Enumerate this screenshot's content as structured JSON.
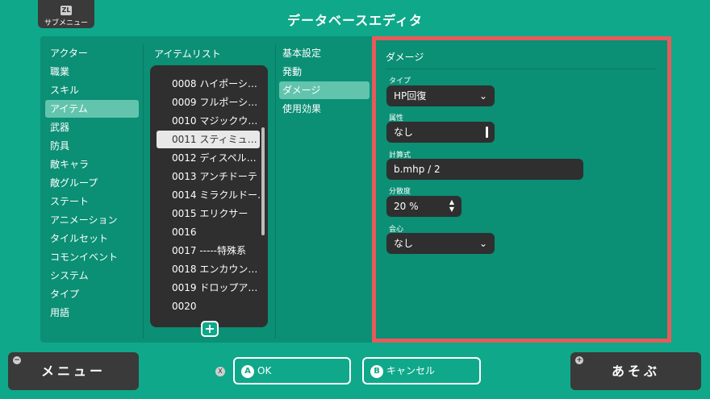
{
  "header": {
    "submenu_button_label": "ZL",
    "submenu_label": "サブメニュー",
    "title": "データベースエディタ"
  },
  "categories": {
    "items": [
      "アクター",
      "職業",
      "スキル",
      "アイテム",
      "武器",
      "防具",
      "敵キャラ",
      "敵グループ",
      "ステート",
      "アニメーション",
      "タイルセット",
      "コモンイベント",
      "システム",
      "タイプ",
      "用語"
    ],
    "selected": "アイテム"
  },
  "item_list": {
    "heading": "アイテムリスト",
    "items": [
      "0008 ハイポーシ…",
      "0009 フルポーシ…",
      "0010 マジックウ…",
      "0011 スティミュ…",
      "0012 ディスペル…",
      "0013 アンチドーテ",
      "0014 ミラクルドー…",
      "0015 エリクサー",
      "0016",
      "0017 -----特殊系",
      "0018 エンカウン…",
      "0019 ドロップア…",
      "0020"
    ],
    "selected": "0011 スティミュ…",
    "add_label": "+"
  },
  "tabs": {
    "items": [
      "基本設定",
      "発動",
      "ダメージ",
      "使用効果"
    ],
    "selected": "ダメージ"
  },
  "damage": {
    "heading": "ダメージ",
    "type_label": "タイプ",
    "type_value": "HP回復",
    "element_label": "属性",
    "element_value": "なし",
    "formula_label": "計算式",
    "formula_value": "b.mhp / 2",
    "variance_label": "分散度",
    "variance_value": "20 %",
    "critical_label": "会心",
    "critical_value": "なし"
  },
  "footer": {
    "menu_icon": "−",
    "menu_label": "メニュー",
    "x_icon": "X",
    "ok_key": "A",
    "ok_label": "OK",
    "cancel_key": "B",
    "cancel_label": "キャンセル",
    "play_icon": "+",
    "play_label": "あそぶ"
  },
  "colors": {
    "background": "#0fa88a",
    "panel": "#0b8f75",
    "highlight_frame": "#e85a5a",
    "selected_row": "#62c4ad",
    "field": "#2f2f2f"
  }
}
